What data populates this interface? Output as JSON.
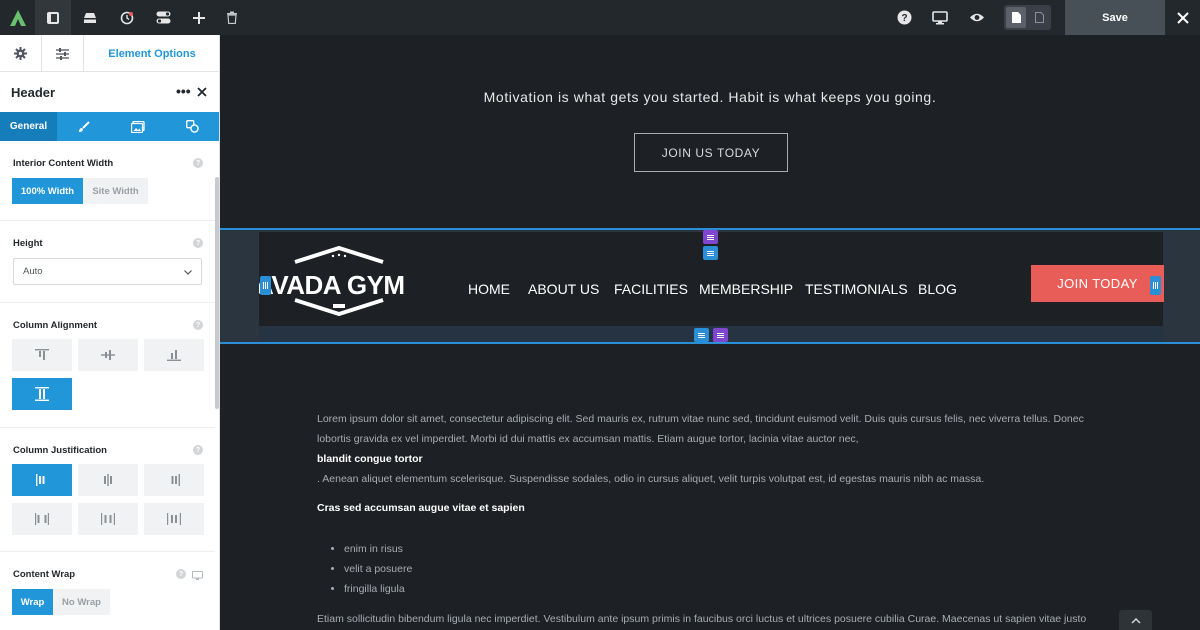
{
  "toolbar": {
    "icons": [
      "avada-logo",
      "sidebar-icon",
      "library-icon",
      "history-icon",
      "toggles-icon",
      "add-icon",
      "trash-icon",
      "help-icon",
      "desktop-icon",
      "preview-icon",
      "page-icon",
      "page-outline-icon",
      "close-icon"
    ],
    "save_label": "Save"
  },
  "panel": {
    "tabs": {
      "element_options": "Element Options"
    },
    "element_title": "Header",
    "subtabs": {
      "general": "General"
    },
    "options": {
      "interior_width": {
        "label": "Interior Content Width",
        "choices": [
          "100% Width",
          "Site Width"
        ],
        "selected": "100% Width"
      },
      "height": {
        "label": "Height",
        "value": "Auto"
      },
      "column_alignment": {
        "label": "Column Alignment",
        "selected": "stretch"
      },
      "column_justification": {
        "label": "Column Justification",
        "selected": "flex-start"
      },
      "content_wrap": {
        "label": "Content Wrap",
        "choices": [
          "Wrap",
          "No Wrap"
        ],
        "selected": "Wrap"
      }
    }
  },
  "canvas": {
    "hero": {
      "subtitle": "Motivation is what gets you started. Habit is what keeps you going.",
      "button": "JOIN US TODAY"
    },
    "header": {
      "logo_text": "AVADA GYM",
      "nav": [
        "HOME",
        "ABOUT US",
        "FACILITIES",
        "MEMBERSHIP",
        "TESTIMONIALS",
        "BLOG"
      ],
      "cta": "JOIN TODAY"
    },
    "content": {
      "p1": "Lorem ipsum dolor sit amet, consectetur adipiscing elit. Sed mauris ex, rutrum vitae nunc sed, tincidunt euismod velit. Duis quis cursus felis, nec viverra tellus. Donec",
      "p1b": "lobortis gravida ex vel imperdiet. Morbi id dui mattis ex accumsan mattis. Etiam augue tortor, lacinia vitae auctor nec,",
      "bold1": "blandit congue tortor",
      "p2": ". Aenean aliquet elementum scelerisque. Suspendisse sodales, odio in cursus aliquet, velit turpis volutpat est, id egestas mauris nibh ac massa.",
      "heading": "Cras sed accumsan augue vitae et sapien",
      "list": [
        "enim in risus",
        "velit a posuere",
        "fringilla ligula"
      ],
      "p3": "Etiam sollicitudin bibendum ligula nec imperdiet. Vestibulum ante ipsum primis in faucibus orci luctus et ultrices posuere cubilia Curae. Maecenas ut sapien vitae justo"
    }
  },
  "colors": {
    "accent": "#2196d9",
    "cta": "#e95d58",
    "purple_handle": "#7f47cf"
  }
}
